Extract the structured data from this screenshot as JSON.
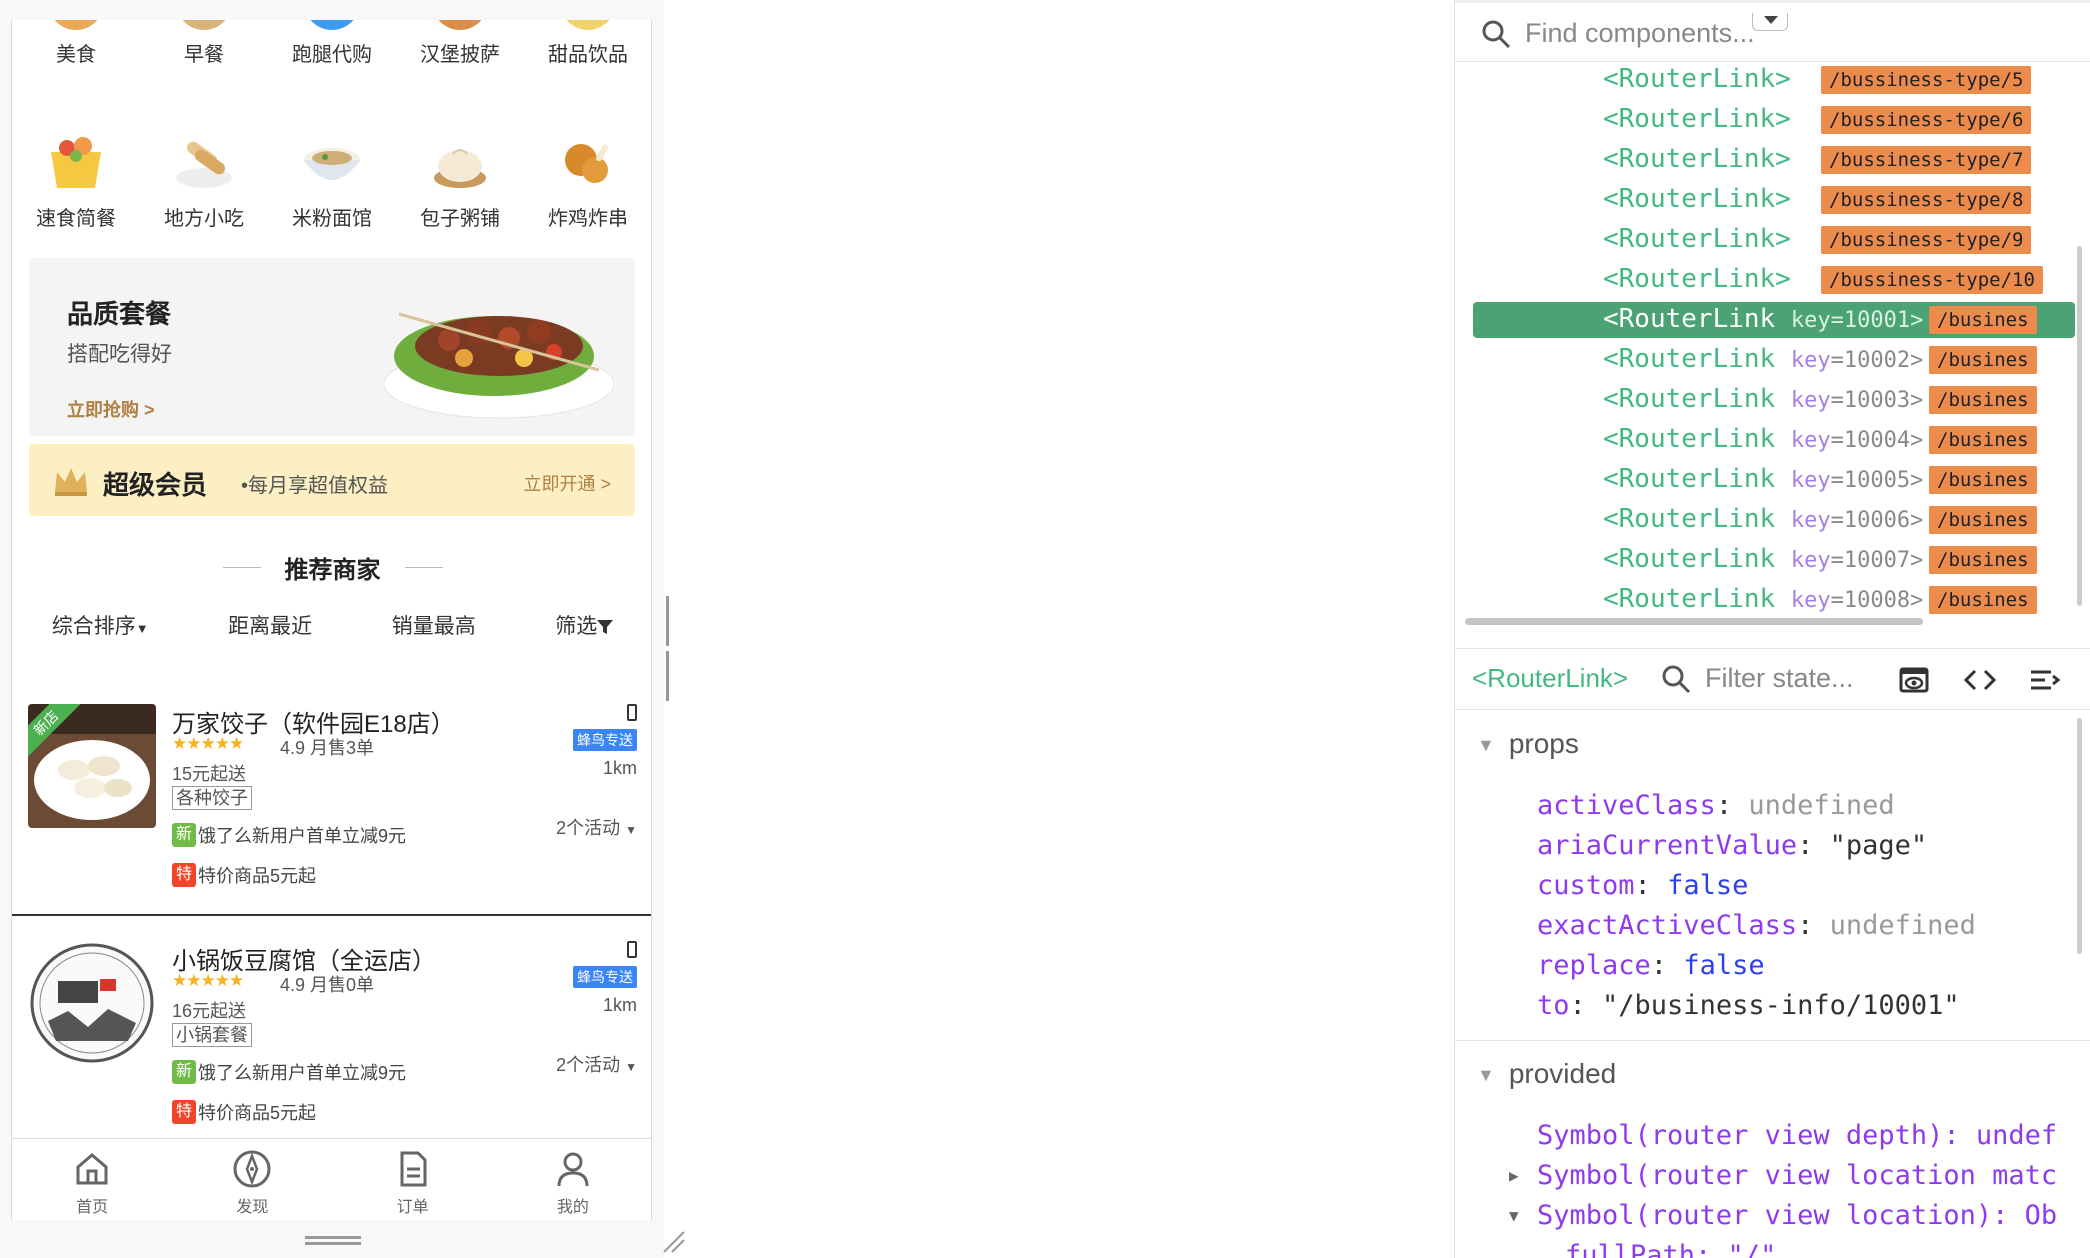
{
  "categories_row1": [
    "美食",
    "早餐",
    "跑腿代购",
    "汉堡披萨",
    "甜品饮品"
  ],
  "categories_row2": [
    "速食简餐",
    "地方小吃",
    "米粉面馆",
    "包子粥铺",
    "炸鸡炸串"
  ],
  "quality": {
    "title": "品质套餐",
    "subtitle": "搭配吃得好",
    "cta": "立即抢购 >"
  },
  "vip": {
    "title": "超级会员",
    "subtitle": "•每月享超值权益",
    "cta": "立即开通 >"
  },
  "recommend_title": "推荐商家",
  "sort": {
    "comprehensive": "综合排序",
    "distance": "距离最近",
    "sales": "销量最高",
    "filter": "筛选"
  },
  "shops": [
    {
      "name": "万家饺子（软件园E18店）",
      "stars": "★★★★★",
      "rating": "4.9 月售3单",
      "min_order": "15元起送",
      "tag": "各种饺子",
      "delivery": "蜂鸟专送",
      "distance": "1km",
      "new_badge": "新店",
      "activity1_badge": "新",
      "activity1": "饿了么新用户首单立减9元",
      "activity2_badge": "特",
      "activity2": "特价商品5元起",
      "activity_count": "2个活动"
    },
    {
      "name": "小锅饭豆腐馆（全运店）",
      "stars": "★★★★★",
      "rating": "4.9 月售0单",
      "min_order": "16元起送",
      "tag": "小锅套餐",
      "delivery": "蜂鸟专送",
      "distance": "1km",
      "activity1_badge": "新",
      "activity1": "饿了么新用户首单立减9元",
      "activity2_badge": "特",
      "activity2": "特价商品5元起",
      "activity_count": "2个活动"
    }
  ],
  "tabs": [
    "首页",
    "发现",
    "订单",
    "我的"
  ],
  "devtools": {
    "search_placeholder": "Find components...",
    "routes": [
      "/bussiness-type/5",
      "/bussiness-type/6",
      "/bussiness-type/7",
      "/bussiness-type/8",
      "/bussiness-type/9",
      "/bussiness-type/10"
    ],
    "keyed_nodes": [
      {
        "key": "10001",
        "route": "/busines",
        "selected": true
      },
      {
        "key": "10002",
        "route": "/busines"
      },
      {
        "key": "10003",
        "route": "/busines"
      },
      {
        "key": "10004",
        "route": "/busines"
      },
      {
        "key": "10005",
        "route": "/busines"
      },
      {
        "key": "10006",
        "route": "/busines"
      },
      {
        "key": "10007",
        "route": "/busines"
      },
      {
        "key": "10008",
        "route": "/busines"
      }
    ],
    "component_tag": "<RouterLink>",
    "filter_placeholder": "Filter state...",
    "props_title": "props",
    "props": {
      "activeClass": "undefined",
      "ariaCurrentValue": "\"page\"",
      "custom": "false",
      "exactActiveClass": "undefined",
      "replace": "false",
      "to": "\"/business-info/10001\""
    },
    "provided_title": "provided",
    "provided": [
      "Symbol(router view depth): undef",
      "Symbol(router view location matc",
      "Symbol(router view location): Ob",
      "fullPath: \"/\""
    ]
  },
  "colors": {
    "vue_green": "#42b883",
    "route_badge": "#ec8b4c",
    "selected_row": "#4ba374"
  }
}
